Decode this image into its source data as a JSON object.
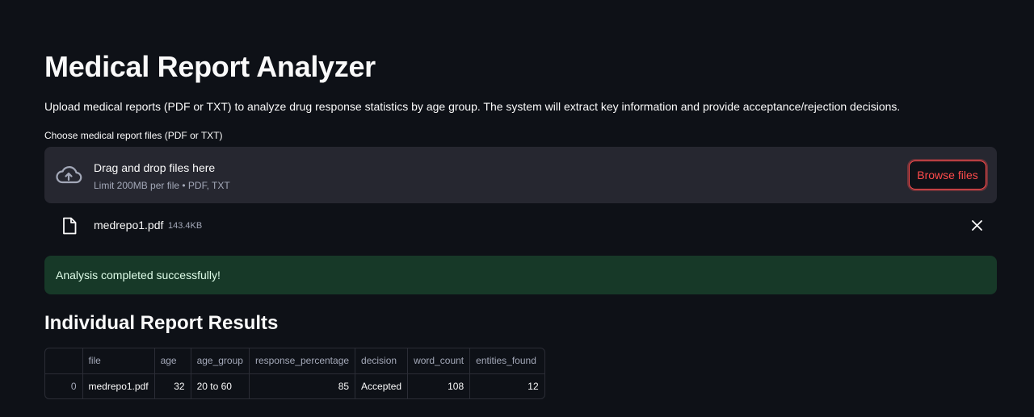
{
  "page": {
    "title": "Medical Report Analyzer",
    "description": "Upload medical reports (PDF or TXT) to analyze drug response statistics by age group. The system will extract key information and provide acceptance/rejection decisions."
  },
  "uploader": {
    "label": "Choose medical report files (PDF or TXT)",
    "dropzone_title": "Drag and drop files here",
    "dropzone_limit": "Limit 200MB per file • PDF, TXT",
    "browse_label": "Browse files",
    "uploaded_file": {
      "name": "medrepo1.pdf",
      "size": "143.4KB"
    }
  },
  "alert": {
    "text": "Analysis completed successfully!"
  },
  "results": {
    "subheader": "Individual Report Results",
    "columns": [
      "",
      "file",
      "age",
      "age_group",
      "response_percentage",
      "decision",
      "word_count",
      "entities_found"
    ],
    "rows": [
      {
        "index": "0",
        "file": "medrepo1.pdf",
        "age": "32",
        "age_group": "20 to 60",
        "response_percentage": "85",
        "decision": "Accepted",
        "word_count": "108",
        "entities_found": "12"
      }
    ]
  },
  "colors": {
    "background": "#0e1117",
    "surface": "#262730",
    "accent": "#ff4b4b",
    "success_bg": "#173928"
  },
  "icons": {
    "upload": "cloud-upload-icon",
    "file": "file-icon",
    "close": "close-icon"
  }
}
